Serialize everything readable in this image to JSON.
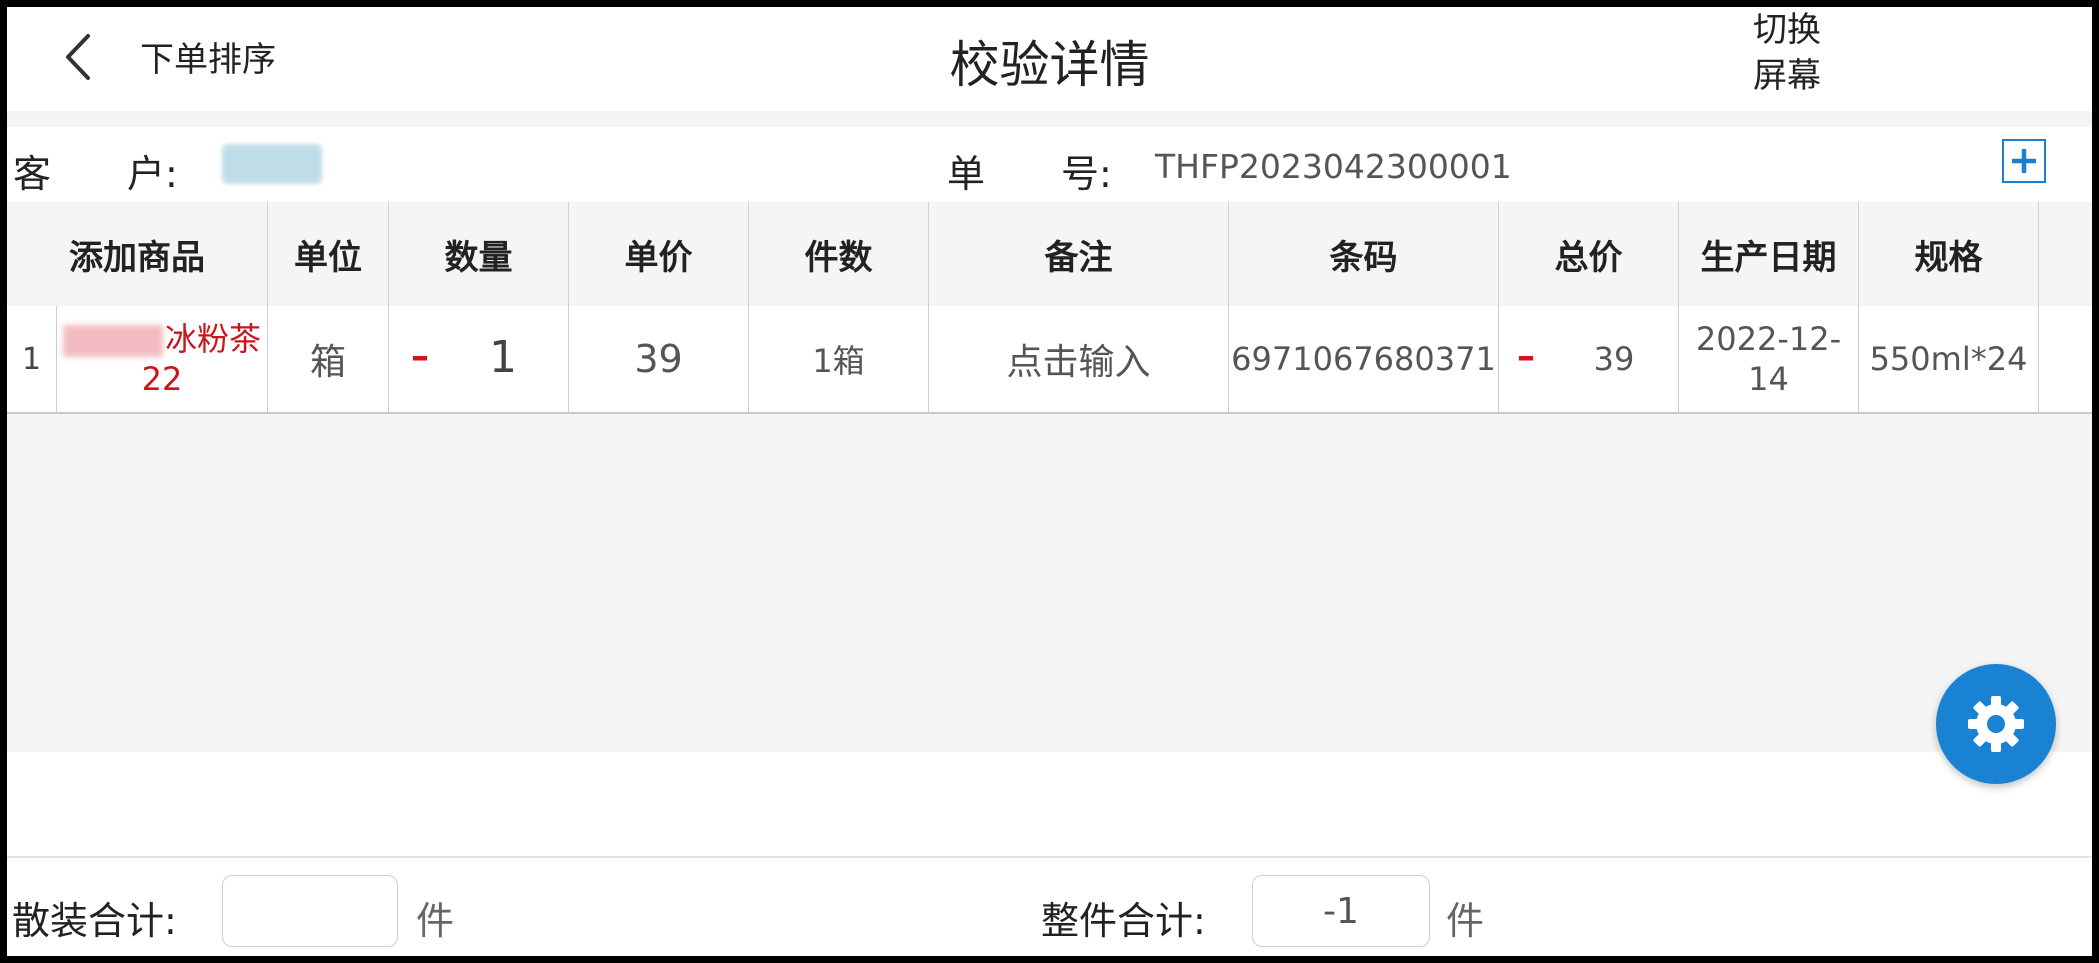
{
  "header": {
    "back_icon": "chevron-left-icon",
    "order_sort": "下单排序",
    "title": "校验详情",
    "switch_screen_line1": "切换",
    "switch_screen_line2": "屏幕"
  },
  "info": {
    "customer_label": "客　　户:",
    "order_label": "单　　号:",
    "order_number": "THFP2023042300001",
    "add_icon": "plus-icon"
  },
  "table": {
    "columns": [
      "添加商品",
      "单位",
      "数量",
      "单价",
      "件数",
      "备注",
      "条码",
      "总价",
      "生产日期",
      "规格"
    ],
    "rows": [
      {
        "index": "1",
        "product_name": "冰粉茶",
        "product_name_line2": "22",
        "unit": "箱",
        "quantity": "1",
        "minus_symbol": "–",
        "unit_price": "39",
        "pieces": "1箱",
        "note": "点击输入",
        "barcode": "6971067680371",
        "total": "39",
        "production_date": "2022-12-14",
        "spec": "550ml*24"
      }
    ]
  },
  "footer": {
    "bulk_label": "散装合计:",
    "bulk_value": "",
    "bulk_unit": "件",
    "whole_label": "整件合计:",
    "whole_value": "-1",
    "whole_unit": "件"
  },
  "colors": {
    "accent": "#1a82d2",
    "danger": "#d3121c",
    "product_text": "#c8161d"
  },
  "fab_icon": "gear-icon"
}
